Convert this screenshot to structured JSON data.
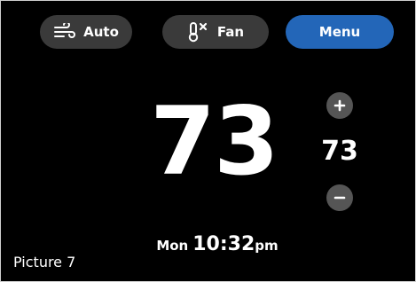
{
  "header": {
    "mode_button": {
      "label": "Auto",
      "icon": "wind-icon"
    },
    "fan_button": {
      "label": "Fan",
      "icon": "thermometer-fan-icon"
    },
    "menu_button": {
      "label": "Menu",
      "color": "#2366b8"
    }
  },
  "main": {
    "current_temperature": "73",
    "setpoint": {
      "value": "73",
      "increase_label": "+",
      "decrease_label": "–"
    }
  },
  "footer": {
    "day": "Mon",
    "time": "10:32",
    "ampm": "pm"
  },
  "caption": "Picture 7",
  "colors": {
    "background": "#000000",
    "pill_gray": "#3a3a3a",
    "round_button_gray": "#555555",
    "accent_blue": "#2366b8"
  }
}
